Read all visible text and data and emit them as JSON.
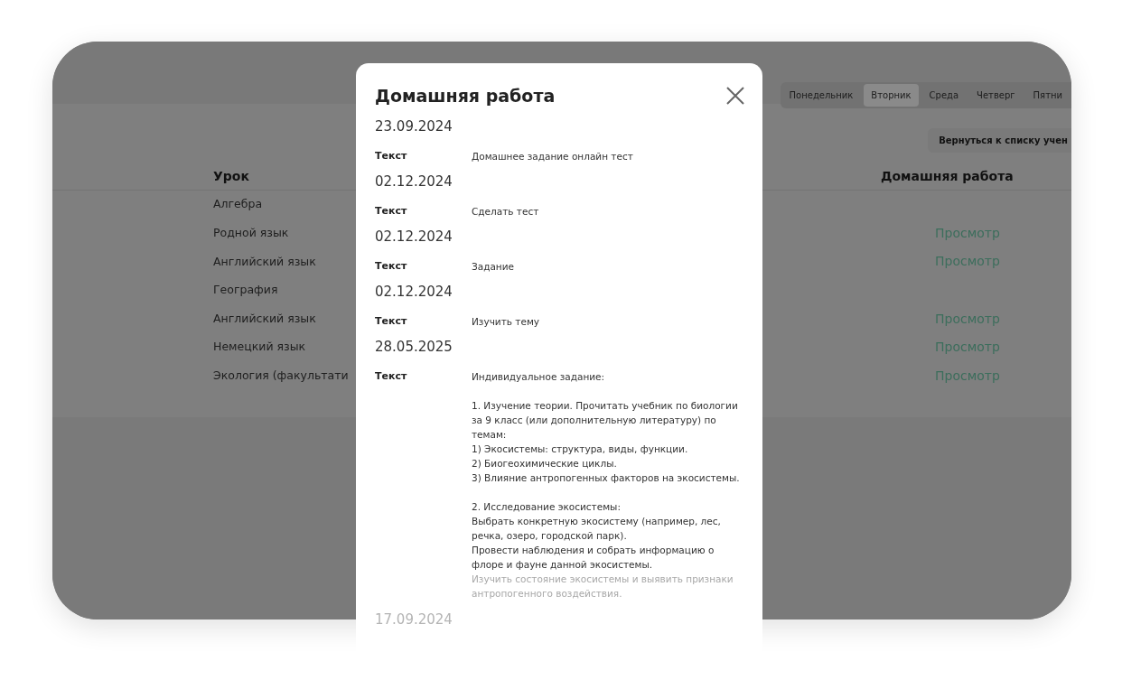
{
  "days": [
    {
      "label": "Понедельник",
      "selected": false
    },
    {
      "label": "Вторник",
      "selected": true
    },
    {
      "label": "Среда",
      "selected": false
    },
    {
      "label": "Четверг",
      "selected": false
    },
    {
      "label": "Пятни",
      "selected": false
    }
  ],
  "back_button": "Вернуться к списку учен",
  "table": {
    "columns": [
      "Урок",
      "Домашняя работа"
    ],
    "rows": [
      {
        "lesson": "Алгебра"
      },
      {
        "lesson": "Родной язык",
        "homework": "Просмотр"
      },
      {
        "lesson": "Английский язык",
        "homework": "Просмотр"
      },
      {
        "lesson": "География"
      },
      {
        "lesson": "Английский язык",
        "homework": "Просмотр"
      },
      {
        "lesson": "Немецкий язык",
        "homework": "Просмотр"
      },
      {
        "lesson": "Экология (факультати",
        "homework": "Просмотр"
      }
    ]
  },
  "modal": {
    "title": "Домашняя работа",
    "entries": [
      {
        "date": "23.09.2024",
        "label": "Текст",
        "text": "Домашнее задание онлайн тест"
      },
      {
        "date": "02.12.2024",
        "label": "Текст",
        "text": "Сделать тест"
      },
      {
        "date": "02.12.2024",
        "label": "Текст",
        "text": "Задание"
      },
      {
        "date": "02.12.2024",
        "label": "Текст",
        "text": "Изучить тему"
      },
      {
        "date": "28.05.2025",
        "label": "Текст",
        "text": "Индивидуальное задание:\n\n1. Изучение теории. Прочитать учебник по биологии за 9 класс (или дополнительную литературу) по темам:\n1) Экосистемы: структура, виды, функции.\n2) Биогеохимические циклы.\n3) Влияние антропогенных факторов на экосистемы.\n\n2. Исследование экосистемы:\nВыбрать конкретную экосистему (например, лес, речка, озеро, городской парк).\nПровести наблюдения и собрать информацию о флоре и фауне данной экосистемы.",
        "faded_text": "Изучить состояние экосистемы и выявить признаки антропогенного воздействия."
      }
    ],
    "faded_date": "17.09.2024"
  }
}
